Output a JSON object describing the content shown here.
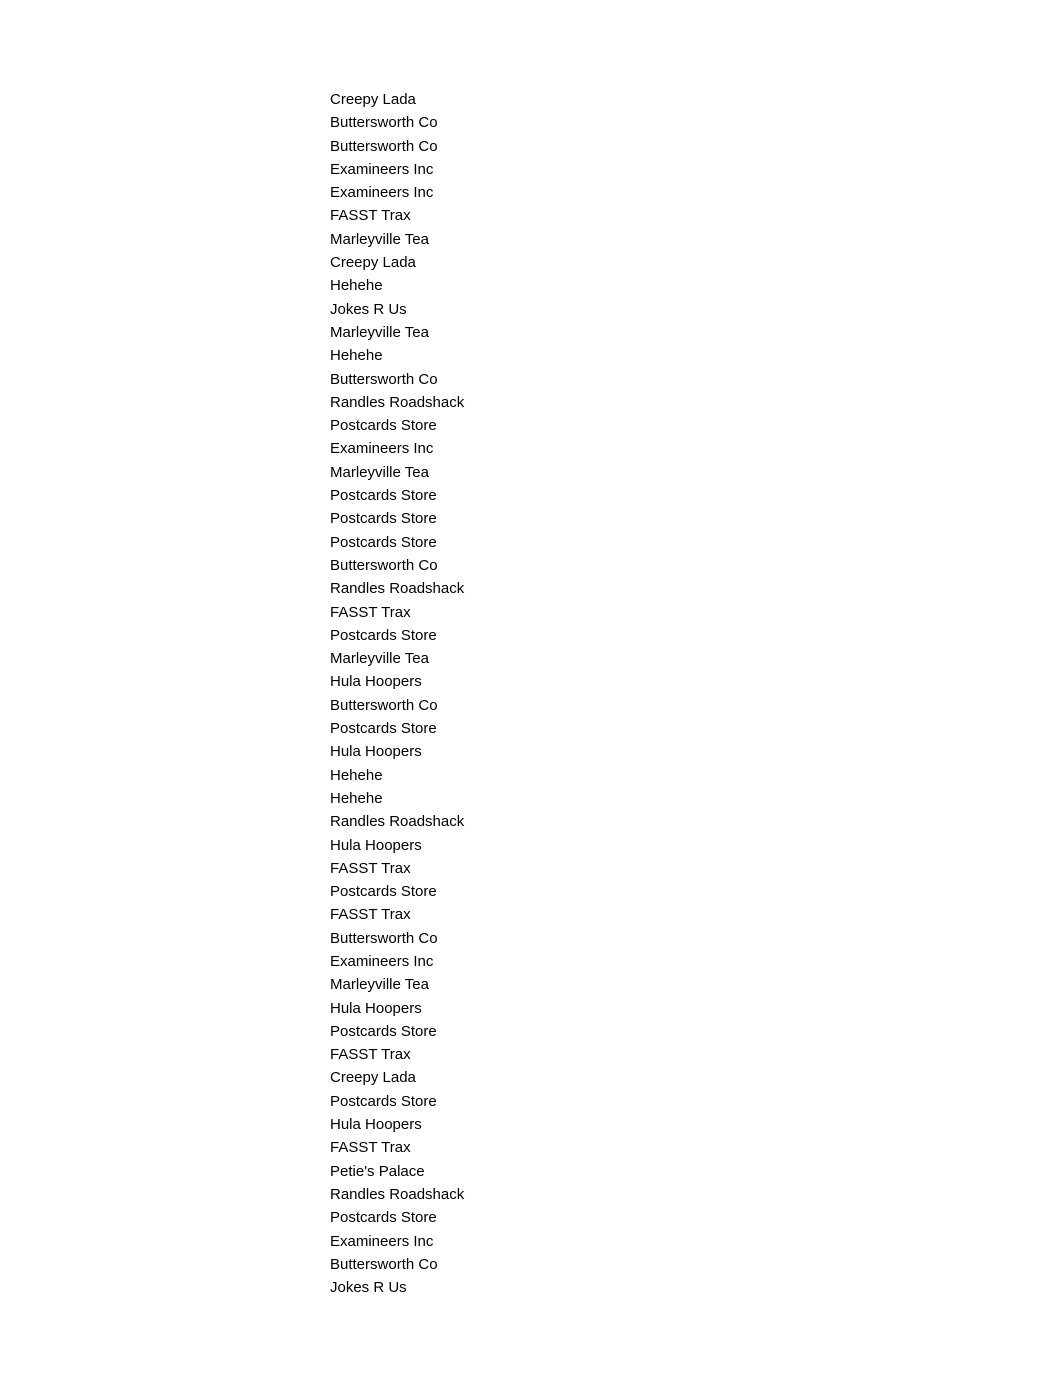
{
  "lines": [
    "Creepy Lada",
    "Buttersworth Co",
    "Buttersworth Co",
    "Examineers Inc",
    "Examineers Inc",
    "FASST Trax",
    "Marleyville Tea",
    "Creepy Lada",
    "Hehehe",
    "Jokes R Us",
    "Marleyville Tea",
    "Hehehe",
    "Buttersworth Co",
    "Randles Roadshack",
    "Postcards Store",
    "Examineers Inc",
    "Marleyville Tea",
    "Postcards Store",
    "Postcards Store",
    "Postcards Store",
    "Buttersworth Co",
    "Randles Roadshack",
    "FASST Trax",
    "Postcards Store",
    "Marleyville Tea",
    "Hula Hoopers",
    "Buttersworth Co",
    "Postcards Store",
    "Hula Hoopers",
    "Hehehe",
    "Hehehe",
    "Randles Roadshack",
    "Hula Hoopers",
    "FASST Trax",
    "Postcards Store",
    "FASST Trax",
    "Buttersworth Co",
    "Examineers Inc",
    "Marleyville Tea",
    "Hula Hoopers",
    "Postcards Store",
    "FASST Trax",
    "Creepy Lada",
    "Postcards Store",
    "Hula Hoopers",
    "FASST Trax",
    "Petie's Palace",
    "Randles Roadshack",
    "Postcards Store",
    "Examineers Inc",
    "Buttersworth Co",
    "Jokes R Us"
  ]
}
